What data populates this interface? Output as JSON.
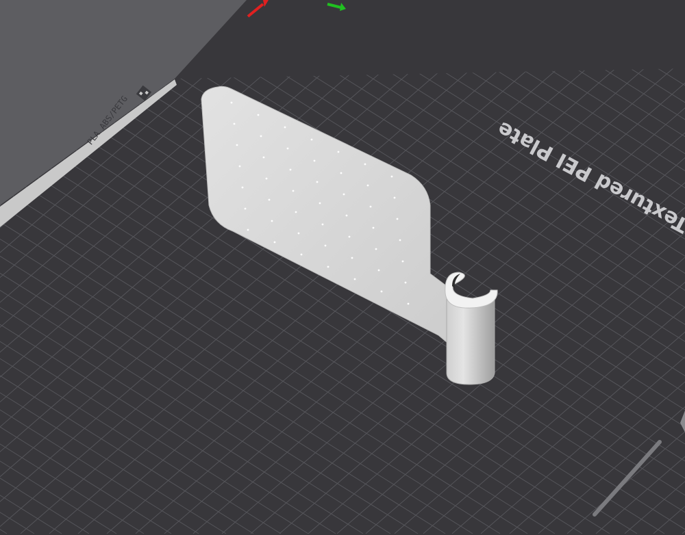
{
  "viewport": {
    "background_color": "#5d5d61",
    "plate_color": "#38373b",
    "grid_color": "#55555a",
    "model_color": "#d9d9d9"
  },
  "bed": {
    "plate_name": "Textured PEI Plate",
    "side_label": "PLA ABS/PETG",
    "side_label_icon": "plate-type-icon"
  },
  "axes": {
    "x_color": "#e02020",
    "y_color": "#20c020"
  },
  "model": {
    "type": "phone-stand-plate-with-clip",
    "hole_pattern": "dot-grid"
  }
}
